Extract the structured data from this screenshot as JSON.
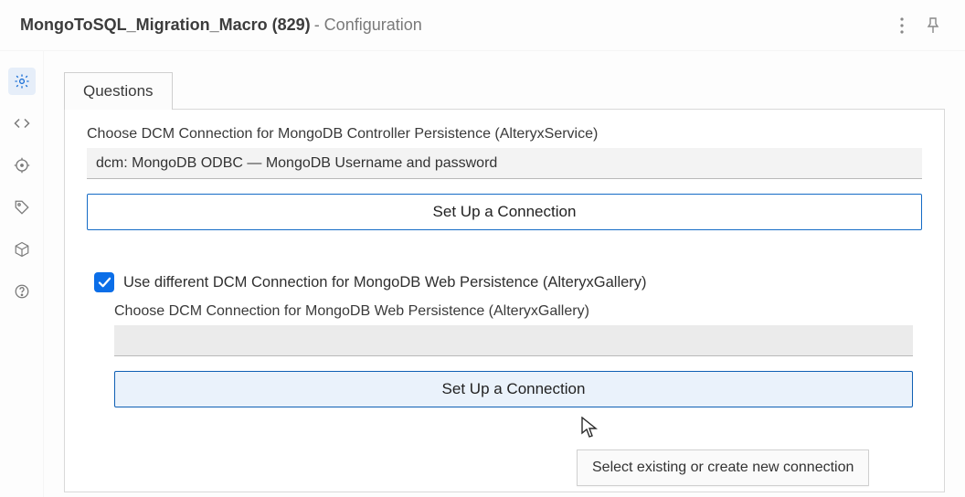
{
  "title": {
    "main": "MongoToSQL_Migration_Macro (829)",
    "sub": " - Configuration"
  },
  "sidebar": {
    "items": [
      {
        "name": "gear-icon",
        "active": true
      },
      {
        "name": "code-icon",
        "active": false
      },
      {
        "name": "target-icon",
        "active": false
      },
      {
        "name": "tag-icon",
        "active": false
      },
      {
        "name": "package-icon",
        "active": false
      },
      {
        "name": "help-icon",
        "active": false
      }
    ]
  },
  "tabs": [
    {
      "label": "Questions"
    }
  ],
  "main": {
    "controller_label": "Choose DCM Connection for MongoDB Controller Persistence (AlteryxService)",
    "controller_value": "dcm: MongoDB ODBC — MongoDB Username and password",
    "setup_btn": "Set Up a Connection",
    "use_diff_conn_label": "Use different DCM Connection for MongoDB Web Persistence (AlteryxGallery)",
    "use_diff_conn_checked": true,
    "web_label": "Choose DCM Connection for MongoDB Web Persistence (AlteryxGallery)",
    "web_value": "",
    "setup_btn2": "Set Up a Connection"
  },
  "tooltip": "Select existing or create new connection"
}
